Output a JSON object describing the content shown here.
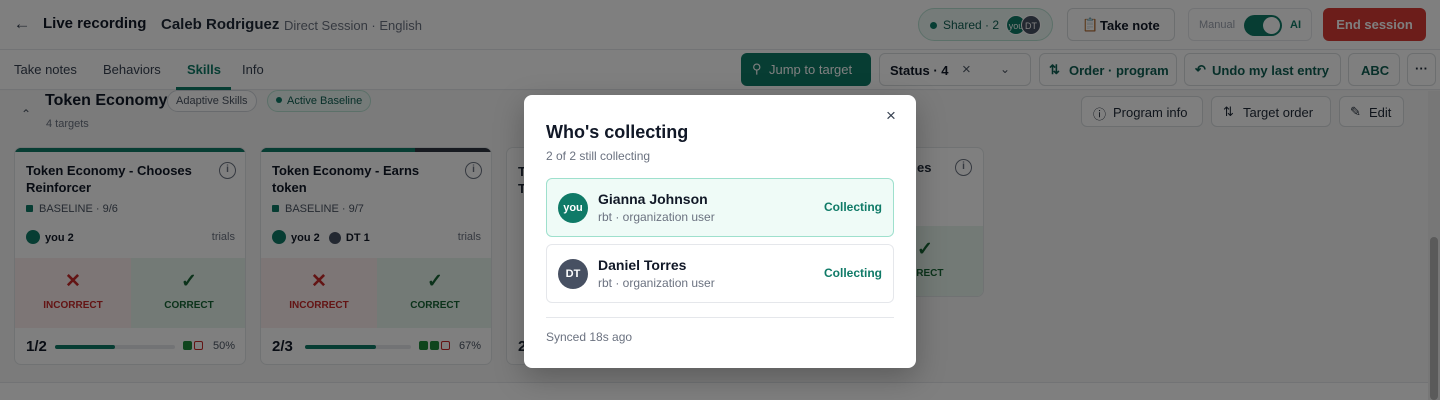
{
  "header": {
    "title": "Live recording",
    "client": "Caleb Rodriguez",
    "session": "Direct Session · English",
    "shared_label": "Shared · 2",
    "shared_avatars": [
      "you",
      "DT"
    ],
    "take_note": "Take note",
    "mode_manual": "Manual",
    "mode_ai": "AI",
    "end_session": "End session"
  },
  "tabs": [
    "Take notes",
    "Behaviors",
    "Skills",
    "Info"
  ],
  "active_tab": "Skills",
  "toolbar": {
    "jump": "Jump to target",
    "status_filter": "Status · 4",
    "order": "Order · program",
    "undo": "Undo my last entry",
    "abc": "ABC",
    "more": "···"
  },
  "program": {
    "title": "Token Economy",
    "tag_domain": "Adaptive Skills",
    "tag_status": "Active Baseline",
    "targets_count": "4 targets",
    "info_btn": "Program info",
    "order_btn": "Target order",
    "edit_btn": "Edit"
  },
  "cards": [
    {
      "title": "Token Economy - Chooses Reinforcer",
      "phase": "BASELINE",
      "phase_count": "9/6",
      "collectors": [
        "you 2"
      ],
      "trials_label": "trials",
      "incorrect_label": "INCORRECT",
      "correct_label": "CORRECT",
      "fraction": "1/2",
      "percent": "50%",
      "progress": 0.5,
      "results": [
        "correct",
        "incorrect"
      ]
    },
    {
      "title": "Token Economy - Earns token",
      "phase": "BASELINE",
      "phase_count": "9/7",
      "collectors": [
        "you 2",
        "DT 1"
      ],
      "trials_label": "trials",
      "incorrect_label": "INCORRECT",
      "correct_label": "CORRECT",
      "fraction": "2/3",
      "percent": "67%",
      "progress": 0.67,
      "results": [
        "correct",
        "correct",
        "incorrect"
      ]
    }
  ],
  "partial_cards": {
    "c_title_1": "T",
    "c_title_2": "T",
    "c_frac": "2",
    "d_title": "es",
    "d_correct": "RRECT"
  },
  "modal": {
    "title": "Who's collecting",
    "subtitle": "2 of 2 still collecting",
    "people": [
      {
        "avatar": "you",
        "name": "Gianna Johnson",
        "role": "rbt · organization user",
        "status": "Collecting"
      },
      {
        "avatar": "DT",
        "name": "Daniel Torres",
        "role": "rbt · organization user",
        "status": "Collecting"
      }
    ],
    "synced": "Synced 18s ago"
  },
  "colors": {
    "brand": "#0f7a67",
    "danger": "#d83a34",
    "dark_avatar": "#475062"
  }
}
